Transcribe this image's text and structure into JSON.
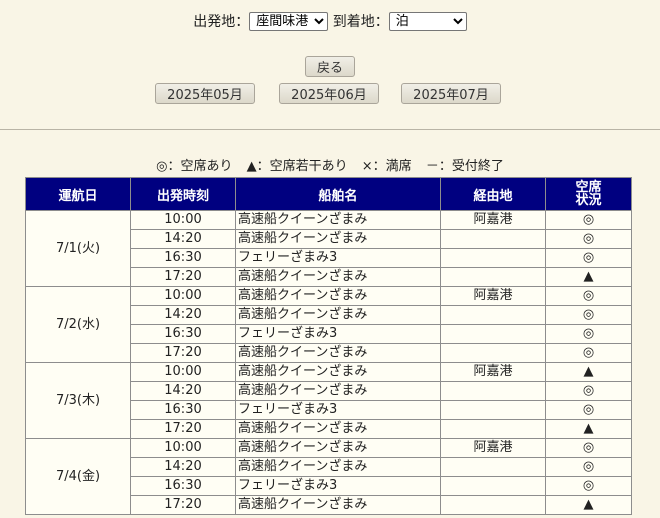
{
  "form": {
    "from_label": "出発地：",
    "from_value": "座間味港",
    "to_label": "到着地：",
    "to_value": "泊"
  },
  "nav": {
    "back_label": "戻る",
    "months": [
      "2025年05月",
      "2025年06月",
      "2025年07月"
    ]
  },
  "legend": {
    "avail": "◎：空席あり",
    "few": "▲：空席若干あり",
    "full": "×：満席",
    "closed": "－：受付終了"
  },
  "table": {
    "headers": {
      "date": "運航日",
      "time": "出発時刻",
      "ship": "船舶名",
      "via": "経由地",
      "status_l1": "空席",
      "status_l2": "状況"
    },
    "days": [
      {
        "date": "7/1(火)",
        "rows": [
          {
            "time": "10:00",
            "ship": "高速船クイーンざまみ",
            "via": "阿嘉港",
            "status": "◎"
          },
          {
            "time": "14:20",
            "ship": "高速船クイーンざまみ",
            "via": "",
            "status": "◎"
          },
          {
            "time": "16:30",
            "ship": "フェリーざまみ3",
            "via": "",
            "status": "◎"
          },
          {
            "time": "17:20",
            "ship": "高速船クイーンざまみ",
            "via": "",
            "status": "▲"
          }
        ]
      },
      {
        "date": "7/2(水)",
        "rows": [
          {
            "time": "10:00",
            "ship": "高速船クイーンざまみ",
            "via": "阿嘉港",
            "status": "◎"
          },
          {
            "time": "14:20",
            "ship": "高速船クイーンざまみ",
            "via": "",
            "status": "◎"
          },
          {
            "time": "16:30",
            "ship": "フェリーざまみ3",
            "via": "",
            "status": "◎"
          },
          {
            "time": "17:20",
            "ship": "高速船クイーンざまみ",
            "via": "",
            "status": "◎"
          }
        ]
      },
      {
        "date": "7/3(木)",
        "rows": [
          {
            "time": "10:00",
            "ship": "高速船クイーンざまみ",
            "via": "阿嘉港",
            "status": "▲"
          },
          {
            "time": "14:20",
            "ship": "高速船クイーンざまみ",
            "via": "",
            "status": "◎"
          },
          {
            "time": "16:30",
            "ship": "フェリーざまみ3",
            "via": "",
            "status": "◎"
          },
          {
            "time": "17:20",
            "ship": "高速船クイーンざまみ",
            "via": "",
            "status": "▲"
          }
        ]
      },
      {
        "date": "7/4(金)",
        "rows": [
          {
            "time": "10:00",
            "ship": "高速船クイーンざまみ",
            "via": "阿嘉港",
            "status": "◎"
          },
          {
            "time": "14:20",
            "ship": "高速船クイーンざまみ",
            "via": "",
            "status": "◎"
          },
          {
            "time": "16:30",
            "ship": "フェリーざまみ3",
            "via": "",
            "status": "◎"
          },
          {
            "time": "17:20",
            "ship": "高速船クイーンざまみ",
            "via": "",
            "status": "▲"
          }
        ]
      }
    ]
  }
}
